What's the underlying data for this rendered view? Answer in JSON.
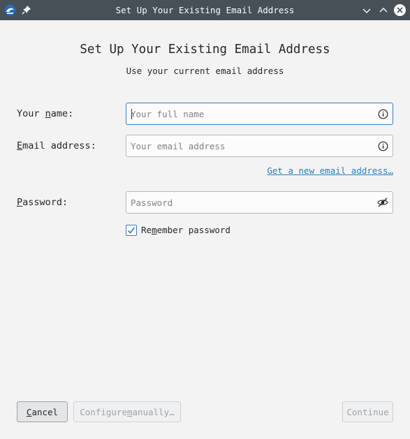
{
  "window": {
    "title": "Set Up Your Existing Email Address",
    "app_icon": "thunderbird-icon",
    "pin_icon": "pin-icon",
    "controls": [
      "chevron-down-icon",
      "chevron-up-icon",
      "close-icon"
    ]
  },
  "header": {
    "title": "Set Up Your Existing Email Address",
    "subtitle": "Use your current email address"
  },
  "form": {
    "name": {
      "label_pre": "Your ",
      "label_accel": "n",
      "label_post": "ame:",
      "value": "",
      "placeholder": "Your full name",
      "trail_icon": "info-icon"
    },
    "email": {
      "label_pre": "",
      "label_accel": "E",
      "label_post": "mail address:",
      "value": "",
      "placeholder": "Your email address",
      "trail_icon": "info-icon"
    },
    "new_email_link": {
      "accel": "G",
      "rest": "et a new email address…"
    },
    "password": {
      "label_pre": "",
      "label_accel": "P",
      "label_post": "assword:",
      "value": "",
      "placeholder": "Password",
      "trail_icon": "eye-slash-icon"
    },
    "remember": {
      "checked": true,
      "label_pre": "Re",
      "label_accel": "m",
      "label_post": "ember password"
    }
  },
  "buttons": {
    "cancel": {
      "accel": "C",
      "rest": "ancel"
    },
    "configure": {
      "pre": "Configure ",
      "accel": "m",
      "post": "anually…"
    },
    "continue": {
      "label": "Continue"
    }
  },
  "colors": {
    "titlebar": "#475057",
    "accent": "#3d7bc4",
    "link": "#2980b9",
    "background": "#f3f3f4"
  }
}
